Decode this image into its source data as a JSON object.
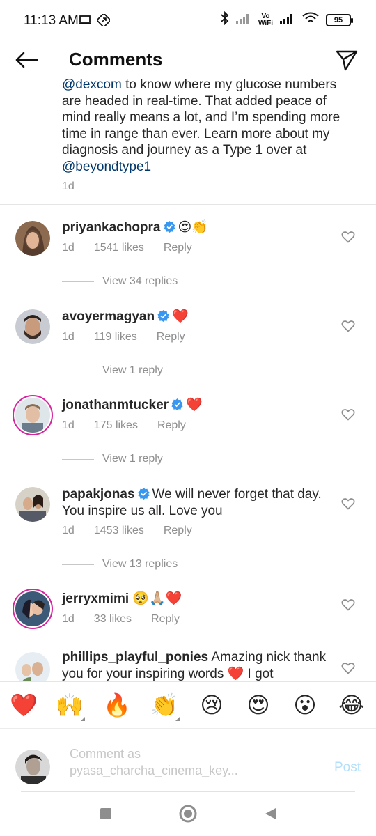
{
  "status_bar": {
    "time": "11:13 AM",
    "left_icons": [
      "laptop-icon",
      "screen-cast-icon"
    ],
    "right_icons": [
      "bluetooth-icon",
      "signal-icon",
      "vowifi-icon",
      "signal-icon",
      "wifi-icon"
    ],
    "vowifi_top": "Vo",
    "vowifi_bottom": "WiFi",
    "battery": "95"
  },
  "header": {
    "title": "Comments",
    "back_icon": "back-arrow-icon",
    "share_icon": "paper-plane-icon"
  },
  "caption": {
    "line_partial": "@dexcom to know where my glucose numbers",
    "text_before_mention": "are headed in real-time. That added peace of mind really means a lot, and I’m spending more time in range than ever. Learn more about my diagnosis and journey as a Type 1 over at ",
    "mention": "@beyondtype1",
    "first_mention": "@dexcom",
    "first_line_rest": " to know where my glucose numbers",
    "time": "1d"
  },
  "comments": [
    {
      "username": "priyankachopra",
      "verified": true,
      "text": "😍👏",
      "time": "1d",
      "likes": "1541 likes",
      "reply": "Reply",
      "view_replies": "View 34 replies"
    },
    {
      "username": "avoyermagyan",
      "verified": true,
      "text": "❤️",
      "time": "1d",
      "likes": "119 likes",
      "reply": "Reply",
      "view_replies": "View 1 reply"
    },
    {
      "username": "jonathanmtucker",
      "verified": true,
      "text": "❤️",
      "time": "1d",
      "likes": "175 likes",
      "reply": "Reply",
      "view_replies": "View 1 reply"
    },
    {
      "username": "papakjonas",
      "verified": true,
      "text": "We will never forget that day. You inspire us all.  Love you",
      "time": "1d",
      "likes": "1453 likes",
      "reply": "Reply",
      "view_replies": "View 13 replies"
    },
    {
      "username": "jerryxmimi",
      "verified": false,
      "text": "🥺🙏🏼❤️",
      "time": "1d",
      "likes": "33 likes",
      "reply": "Reply"
    },
    {
      "username": "phillips_playful_ponies",
      "verified": false,
      "text": "Amazing nick thank you for your inspiring words ❤️ I got"
    }
  ],
  "emoji_bar": [
    "❤️",
    "🙌",
    "🔥",
    "👏",
    "😢",
    "😍",
    "😮",
    "😂"
  ],
  "composer": {
    "placeholder": "Comment as pyasa_charcha_cinema_key...",
    "post": "Post"
  },
  "nav_bar": [
    "recents-square-icon",
    "home-circle-icon",
    "back-triangle-icon"
  ],
  "colors": {
    "link": "#00376b",
    "secondary_text": "#8e8e8e",
    "verified_blue": "#3897f0",
    "post_disabled": "#b2dffc",
    "story_ring": "#d6249f"
  }
}
